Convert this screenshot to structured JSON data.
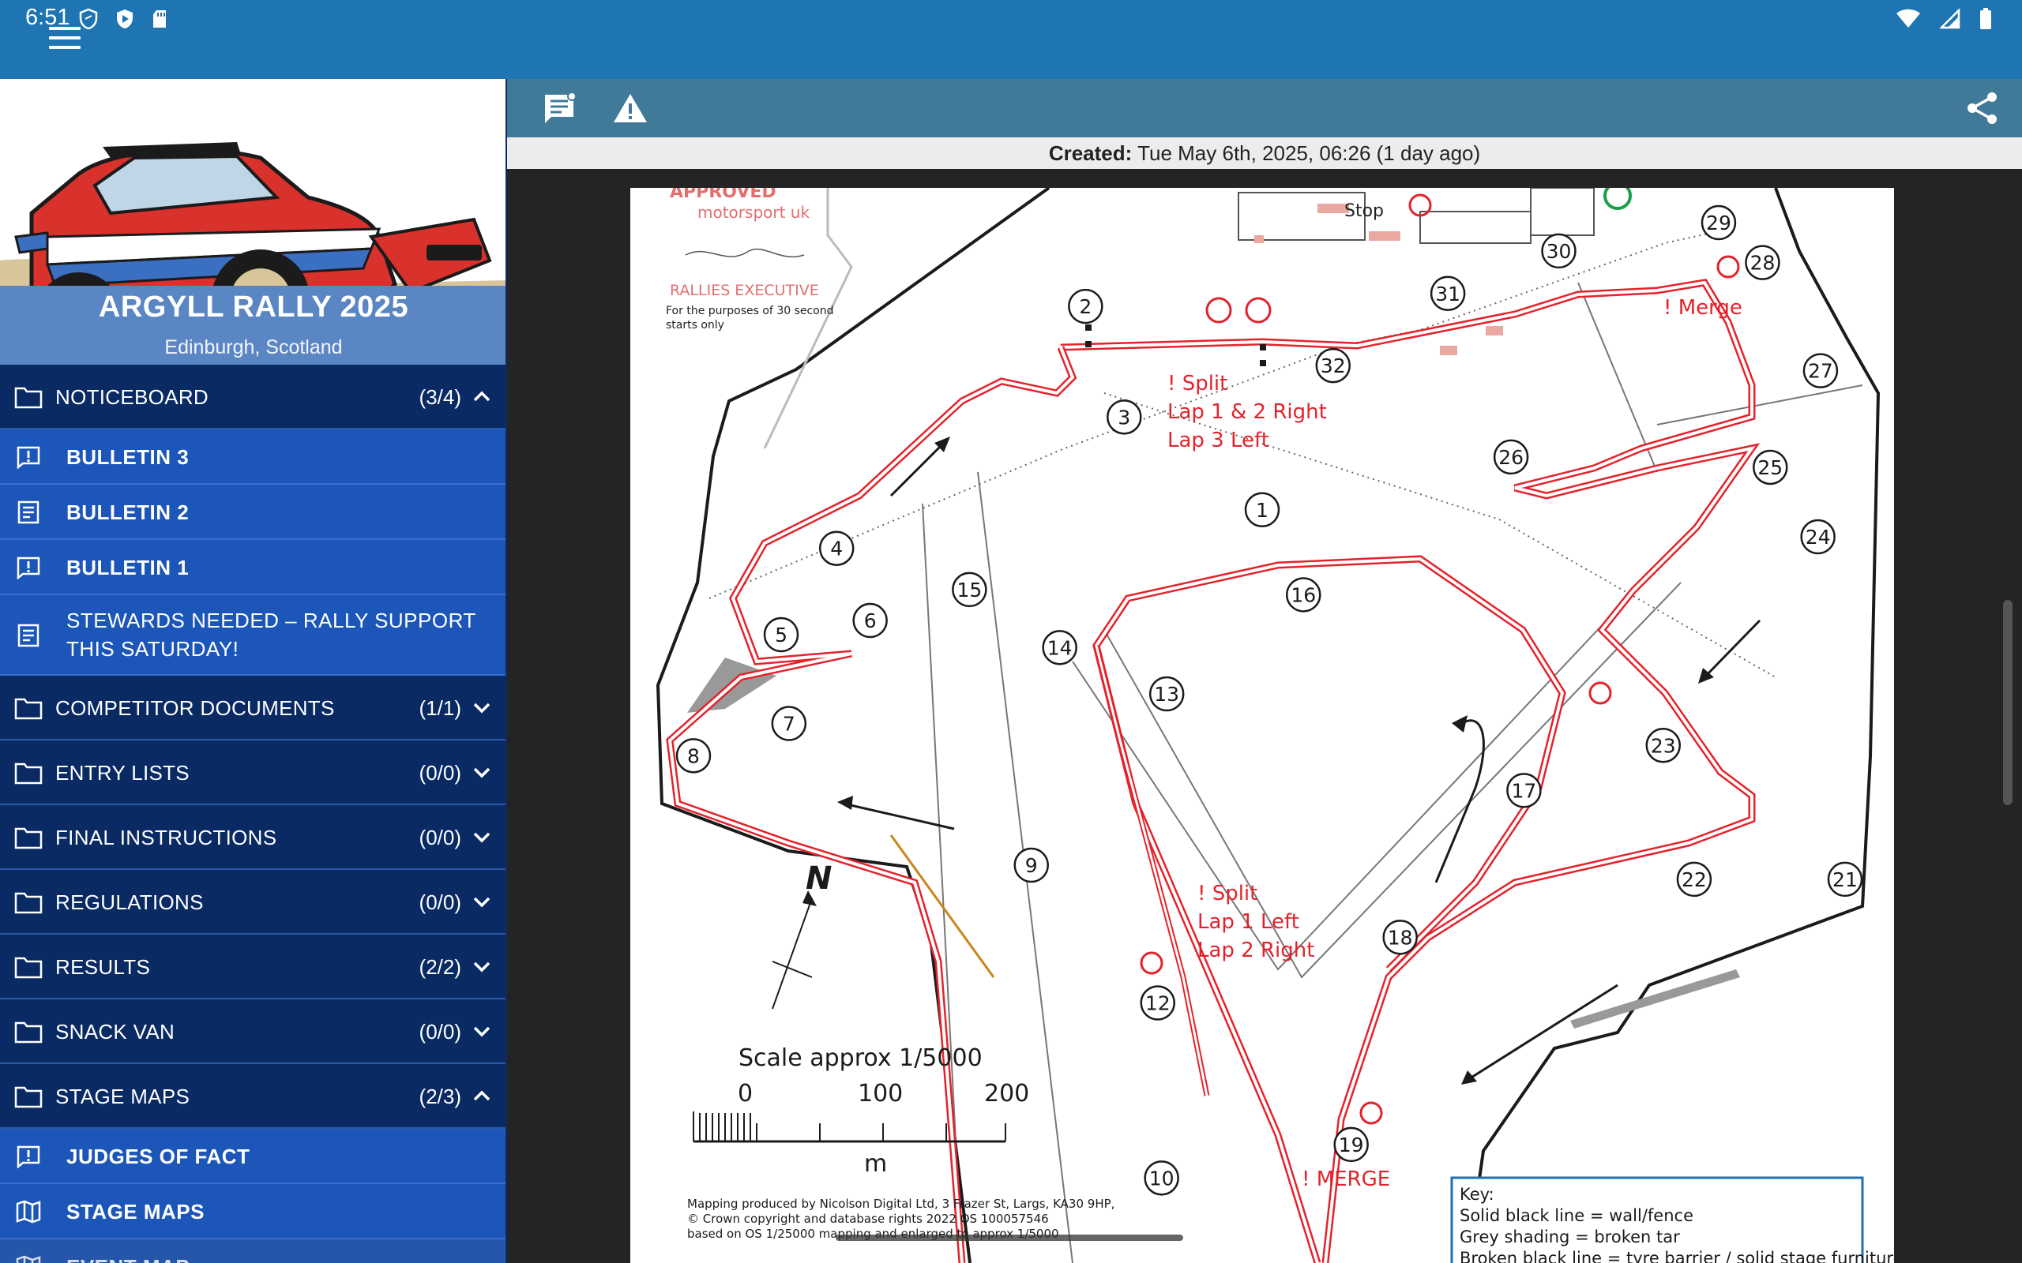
{
  "status": {
    "time": "6:51"
  },
  "app": {
    "title": "ARGYLL RALLY 2025",
    "location": "Edinburgh, Scotland"
  },
  "sidebar": {
    "sections": [
      {
        "label": "NOTICEBOARD",
        "count": "(3/4)",
        "expanded": true,
        "items": [
          {
            "label": "BULLETIN 3",
            "icon": "alert-message-icon"
          },
          {
            "label": "BULLETIN 2",
            "icon": "document-icon"
          },
          {
            "label": "BULLETIN 1",
            "icon": "alert-message-icon"
          },
          {
            "label": "STEWARDS NEEDED – RALLY SUPPORT THIS SATURDAY!",
            "icon": "document-icon"
          }
        ]
      },
      {
        "label": "COMPETITOR DOCUMENTS",
        "count": "(1/1)",
        "expanded": false
      },
      {
        "label": "ENTRY LISTS",
        "count": "(0/0)",
        "expanded": false
      },
      {
        "label": "FINAL INSTRUCTIONS",
        "count": "(0/0)",
        "expanded": false
      },
      {
        "label": "REGULATIONS",
        "count": "(0/0)",
        "expanded": false
      },
      {
        "label": "RESULTS",
        "count": "(2/2)",
        "expanded": false
      },
      {
        "label": "SNACK VAN",
        "count": "(0/0)",
        "expanded": false
      },
      {
        "label": "STAGE MAPS",
        "count": "(2/3)",
        "expanded": true,
        "items": [
          {
            "label": "JUDGES OF FACT",
            "icon": "alert-message-icon"
          },
          {
            "label": "STAGE MAPS",
            "icon": "map-icon"
          },
          {
            "label": "EVENT MAP",
            "icon": "map-icon"
          }
        ]
      }
    ]
  },
  "document": {
    "created_label": "Created:",
    "created_value": "Tue May 6th, 2025, 06:26 (1 day ago)"
  },
  "map": {
    "approved_text": "APPROVED",
    "motorsport_text": "motorsport uk",
    "rallies_exec_text": "RALLIES EXECUTIVE",
    "thirty_sec_text_1": "For the purposes of 30 second",
    "thirty_sec_text_2": "starts only",
    "stop_label": "Stop",
    "merge_top": "! Merge",
    "split_1_a": "! Split",
    "split_1_b": "Lap 1 & 2 Right",
    "split_1_c": "Lap 3 Left",
    "split_2_a": "! Split",
    "split_2_b": "Lap 1 Left",
    "split_2_c": "Lap 2 Right",
    "merge_bottom": "! MERGE",
    "north": "N",
    "scale_title": "Scale approx 1/5000",
    "scale_0": "0",
    "scale_100": "100",
    "scale_200": "200",
    "scale_unit": "m",
    "credit_1": "Mapping produced  by Nicolson Digital Ltd, 3 Frazer St, Largs, KA30 9HP,",
    "credit_2": "© Crown copyright and database rights 2022 OS 100057546",
    "credit_3": "based on OS 1/25000 mapping and enlarged to approx 1/5000",
    "key_title": "Key:",
    "key_1": "Solid black line = wall/fence",
    "key_2": "Grey shading = broken tar",
    "key_3": "Broken black line = tyre barrier / solid stage furniture",
    "waypoints": [
      "1",
      "2",
      "3",
      "4",
      "5",
      "6",
      "7",
      "8",
      "9",
      "10",
      "12",
      "13",
      "14",
      "15",
      "16",
      "17",
      "18",
      "19",
      "21",
      "22",
      "23",
      "24",
      "25",
      "26",
      "27",
      "28",
      "29",
      "30",
      "31",
      "32"
    ]
  }
}
